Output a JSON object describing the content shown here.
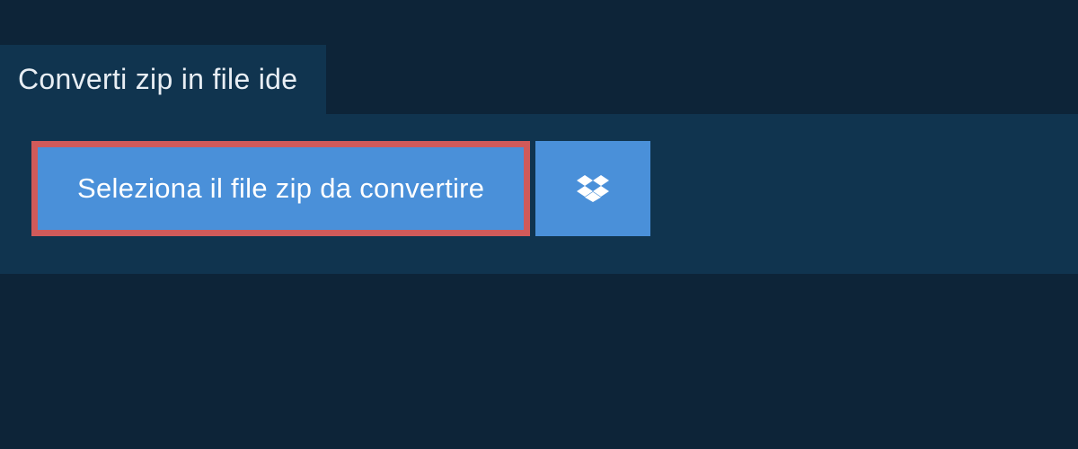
{
  "tab": {
    "title": "Converti zip in file ide"
  },
  "actions": {
    "select_file_label": "Seleziona il file zip da convertire"
  },
  "icons": {
    "dropbox": "dropbox-icon"
  },
  "colors": {
    "background": "#0d2438",
    "panel": "#10344f",
    "button": "#4a90d9",
    "button_border": "#d05a5a",
    "text": "#ffffff"
  }
}
